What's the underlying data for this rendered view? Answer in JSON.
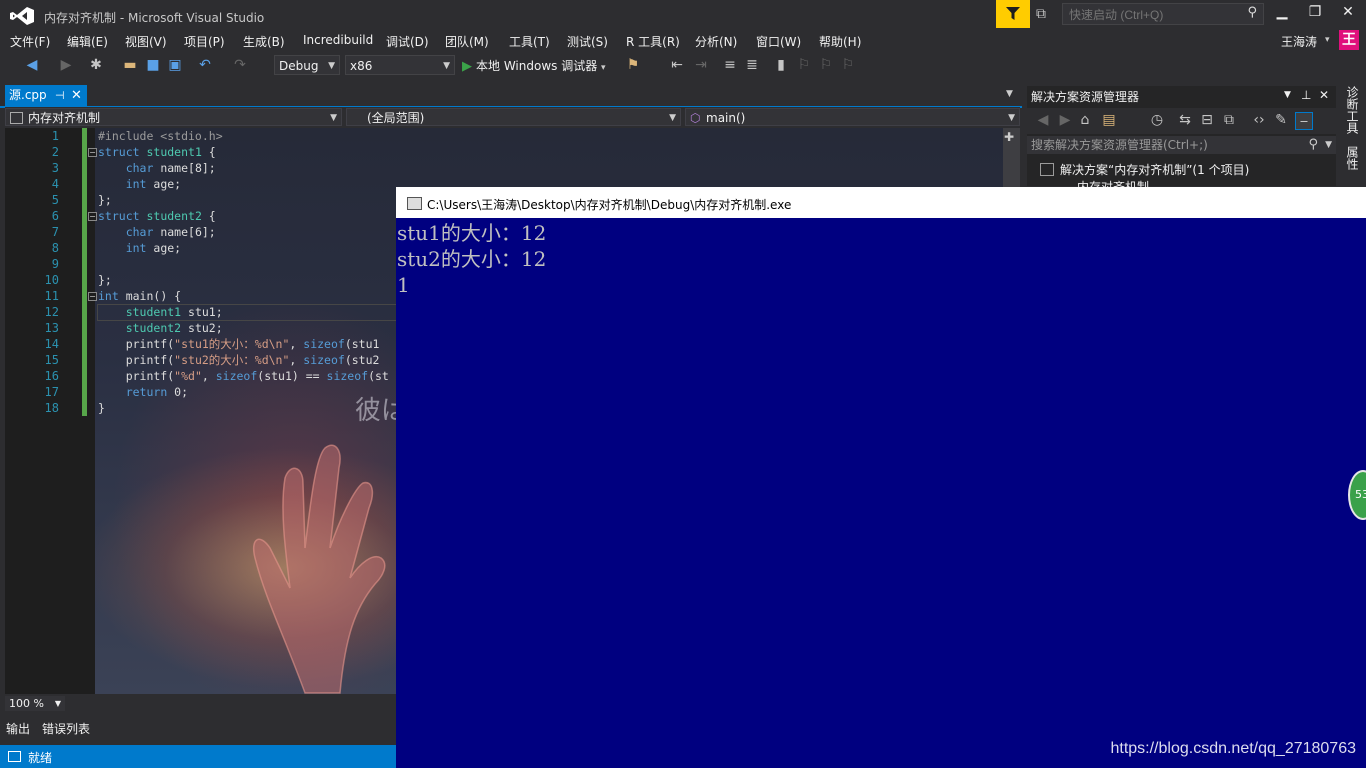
{
  "window": {
    "title": "内存对齐机制 - Microsoft Visual Studio",
    "quick_launch_placeholder": "快速启动 (Ctrl+Q)",
    "user_name": "王海涛",
    "user_initial": "王"
  },
  "menu": [
    "文件(F)",
    "编辑(E)",
    "视图(V)",
    "项目(P)",
    "生成(B)",
    "Incredibuild",
    "调试(D)",
    "团队(M)",
    "工具(T)",
    "测试(S)",
    "R 工具(R)",
    "分析(N)",
    "窗口(W)",
    "帮助(H)"
  ],
  "toolbar": {
    "configuration": "Debug",
    "platform": "x86",
    "run_label": "本地 Windows 调试器"
  },
  "document_tab": {
    "label": "源.cpp",
    "pin": "⊣",
    "close": "✕"
  },
  "navbar": {
    "project": "内存对齐机制",
    "scope": "(全局范围)",
    "member": "main()"
  },
  "editor": {
    "line_numbers": [
      "1",
      "2",
      "3",
      "4",
      "5",
      "6",
      "7",
      "8",
      "9",
      "10",
      "11",
      "12",
      "13",
      "14",
      "15",
      "16",
      "17",
      "18"
    ],
    "background_text": "彼は誰。",
    "zoom": "100 %"
  },
  "bottom_tabs": [
    "输出",
    "错误列表"
  ],
  "status": "就绪",
  "solution_explorer": {
    "title": "解决方案资源管理器",
    "search_placeholder": "搜索解决方案资源管理器(Ctrl+;)",
    "root": "解决方案“内存对齐机制”(1 个项目)",
    "project": "内存对齐机制"
  },
  "side_tabs": [
    "诊断工具",
    "属性"
  ],
  "console": {
    "title": "C:\\Users\\王海涛\\Desktop\\内存对齐机制\\Debug\\内存对齐机制.exe",
    "lines": [
      "stu1的大小：12",
      "stu2的大小：12",
      "1"
    ],
    "watermark": "https://blog.csdn.net/qq_27180763"
  },
  "badge": "53"
}
